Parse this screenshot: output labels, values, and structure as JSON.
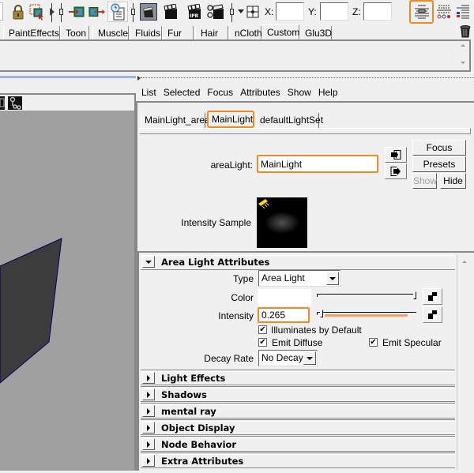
{
  "toolbar": {
    "icons": [
      "lock-icon",
      "select-icon",
      "input-connection-icon",
      "output-connection-icon",
      "history-icon",
      "render-view-icon",
      "render-frame-icon",
      "ipr-render-icon",
      "render-settings-icon",
      "snap-icon"
    ],
    "coords": {
      "x_label": "X:",
      "y_label": "Y:",
      "z_label": "Z:",
      "x_value": "",
      "y_value": "",
      "z_value": ""
    },
    "right_icons": [
      "attribute-editor-icon",
      "tool-settings-icon",
      "channel-box-icon"
    ]
  },
  "shelf": {
    "tabs": [
      "PaintEffects",
      "Toon",
      "Muscle",
      "Fluids",
      "Fur",
      "Hair",
      "nCloth",
      "Custom",
      "Glu3D"
    ],
    "active_tab": "Custom"
  },
  "attribute_editor": {
    "menu": [
      "List",
      "Selected",
      "Focus",
      "Attributes",
      "Show",
      "Help"
    ],
    "node_tabs": [
      "MainLight_area",
      "MainLight",
      "defaultLightSet"
    ],
    "active_node_tab": "MainLight",
    "node_type_label": "areaLight:",
    "node_name": "MainLight",
    "buttons": {
      "focus": "Focus",
      "presets": "Presets",
      "show": "Show",
      "hide": "Hide"
    },
    "intensity_sample_label": "Intensity Sample",
    "sections": {
      "area_light": {
        "title": "Area Light Attributes",
        "expanded": true,
        "type_label": "Type",
        "type_value": "Area Light",
        "color_label": "Color",
        "color_value": "#ffffff",
        "color_slider": 1.0,
        "intensity_label": "Intensity",
        "intensity_value": "0.265",
        "intensity_slider": 0.0,
        "illuminates_by_default": {
          "label": "Illuminates by Default",
          "checked": true
        },
        "emit_diffuse": {
          "label": "Emit Diffuse",
          "checked": true
        },
        "emit_specular": {
          "label": "Emit Specular",
          "checked": true
        },
        "decay_label": "Decay Rate",
        "decay_value": "No Decay"
      },
      "collapsed": [
        "Light Effects",
        "Shadows",
        "mental ray",
        "Object Display",
        "Node Behavior",
        "Extra Attributes"
      ]
    }
  },
  "colors": {
    "highlight": "#f08a24",
    "viewport_bg": "#a0a0a0",
    "mesh_fill": "#3c3c3c",
    "mesh_edge": "#000060"
  }
}
